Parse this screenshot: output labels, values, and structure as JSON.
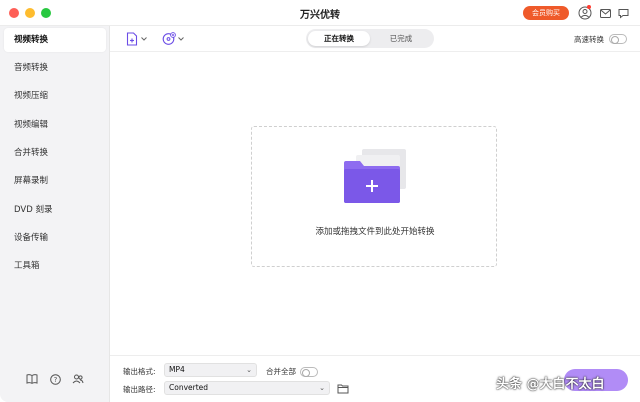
{
  "window": {
    "title": "万兴优转",
    "member_button": "会员购买"
  },
  "sidebar": {
    "items": [
      {
        "label": "视频转换",
        "active": true
      },
      {
        "label": "音频转换"
      },
      {
        "label": "视频压缩"
      },
      {
        "label": "视频编辑"
      },
      {
        "label": "合并转换"
      },
      {
        "label": "屏幕录制"
      },
      {
        "label": "DVD 刻录"
      },
      {
        "label": "设备传输"
      },
      {
        "label": "工具箱"
      }
    ],
    "bottom_icons": [
      "book-icon",
      "help-icon",
      "users-icon"
    ]
  },
  "toolbar": {
    "tabs": [
      "正在转换",
      "已完成"
    ],
    "active_tab": "正在转换",
    "high_speed_label": "高速转换",
    "high_speed_on": false
  },
  "dropzone": {
    "hint": "添加或拖拽文件到此处开始转换"
  },
  "bottom": {
    "format_label": "输出格式:",
    "format_value": "MP4",
    "merge_label": "合并全部",
    "merge_on": false,
    "path_label": "输出路径:",
    "path_value": "Converted"
  },
  "watermark": "头条 @大白不太白",
  "colors": {
    "accent": "#ef5a2a",
    "folder": "#8e6cf0",
    "convert": "#b18cf6"
  }
}
